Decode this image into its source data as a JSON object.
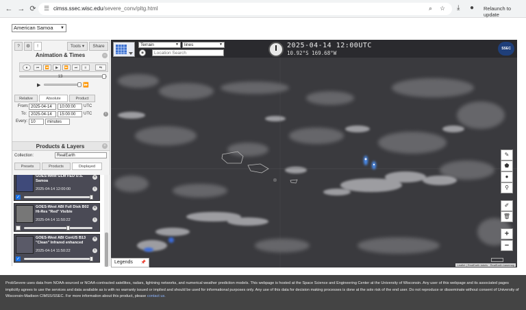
{
  "browser": {
    "url_domain": "cimss.ssec.wisc.edu",
    "url_path": "/severe_conv/pltg.html",
    "relaunch_label": "Relaunch to update"
  },
  "region": {
    "selected": "American Samoa"
  },
  "left_panel": {
    "top_tabs": [
      "?",
      "⚙",
      "!"
    ],
    "tools_label": "Tools ▾",
    "share_label": "Share",
    "animation_title": "Animation & Times",
    "frame_counter": "13",
    "mode_tabs": [
      "Relative",
      "Absolute",
      "Product"
    ],
    "from_label": "From:",
    "from_date": "2025-04-14",
    "from_time": "10:00:00",
    "to_label": "To:",
    "to_date": "2025-04-14",
    "to_time": "15:00:00",
    "utc": "UTC",
    "every_label": "Every:",
    "every_value": "10",
    "every_unit": "minutes",
    "products_title": "Products & Layers",
    "collection_label": "Collection:",
    "collection_value": "RealEarth",
    "list_tabs": [
      "Presets",
      "Products",
      "Displayed"
    ],
    "layers": [
      {
        "name": "GOES-West GLM FED U.S. Samoa",
        "time": "2025-04-14 12:00:00",
        "checked": true,
        "opacity": 1.0
      },
      {
        "name": "GOES-West ABI Full Disk B02 Hi-Res \"Red\" Visible",
        "time": "2025-04-14 11:50:22",
        "checked": false,
        "opacity": 0.63
      },
      {
        "name": "GOES-West ABI ConUS B13 \"Clean\" Infrared enhanced",
        "time": "2025-04-14 11:50:22",
        "checked": true,
        "opacity": 1.0
      }
    ]
  },
  "map": {
    "basemap": "Terrain",
    "overlay": "lines",
    "location_placeholder": "Location Search",
    "datetime": "2025-04-14 12:00UTC",
    "coords": "10.92°S 169.68°W",
    "logo": "SSEC",
    "legends_label": "Legends",
    "attribution": "Leaflet | RealEarth labels · RealEarth basemap",
    "tools": [
      "pencil-icon",
      "polygon-icon",
      "point-icon",
      "marker-icon",
      "edit-icon",
      "trash-icon",
      "zoom-in-icon",
      "zoom-out-icon"
    ]
  },
  "footer": {
    "text": "ProbSevere uses data from NOAA-sourced or NOAA-contracted satellites, radars, lightning networks, and numerical weather prediction models. This webpage is hosted at the Space Science and Engineering Center at the University of Wisconsin. Any user of this webpage and its associated pages implicitly agrees to use the services and data available as is with no warranty issued or implied and should be used for informational purposes only. Any use of this data for decision making processes is done at the sole risk of the end user. Do not reproduce or disseminate without consent of University of Wisconsin-Madison CIMSS/SSEC. For more information about this product, please",
    "link": "contact us."
  }
}
